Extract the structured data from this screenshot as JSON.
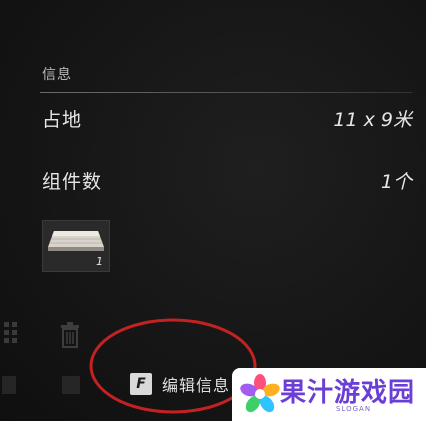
{
  "info_panel": {
    "section_title": "信息",
    "footprint": {
      "label": "占地",
      "value": "11 x 9米"
    },
    "components": {
      "label": "组件数",
      "value": "1个"
    },
    "item_slot": {
      "count": "1"
    }
  },
  "actions": {
    "edit_key": "F",
    "edit_label": "编辑信息"
  },
  "annotation": {
    "color": "#c42222"
  },
  "watermark": {
    "logo_text": "果汁游戏园",
    "slogan": "SLOGAN",
    "text_color": "#6b3fd6"
  }
}
